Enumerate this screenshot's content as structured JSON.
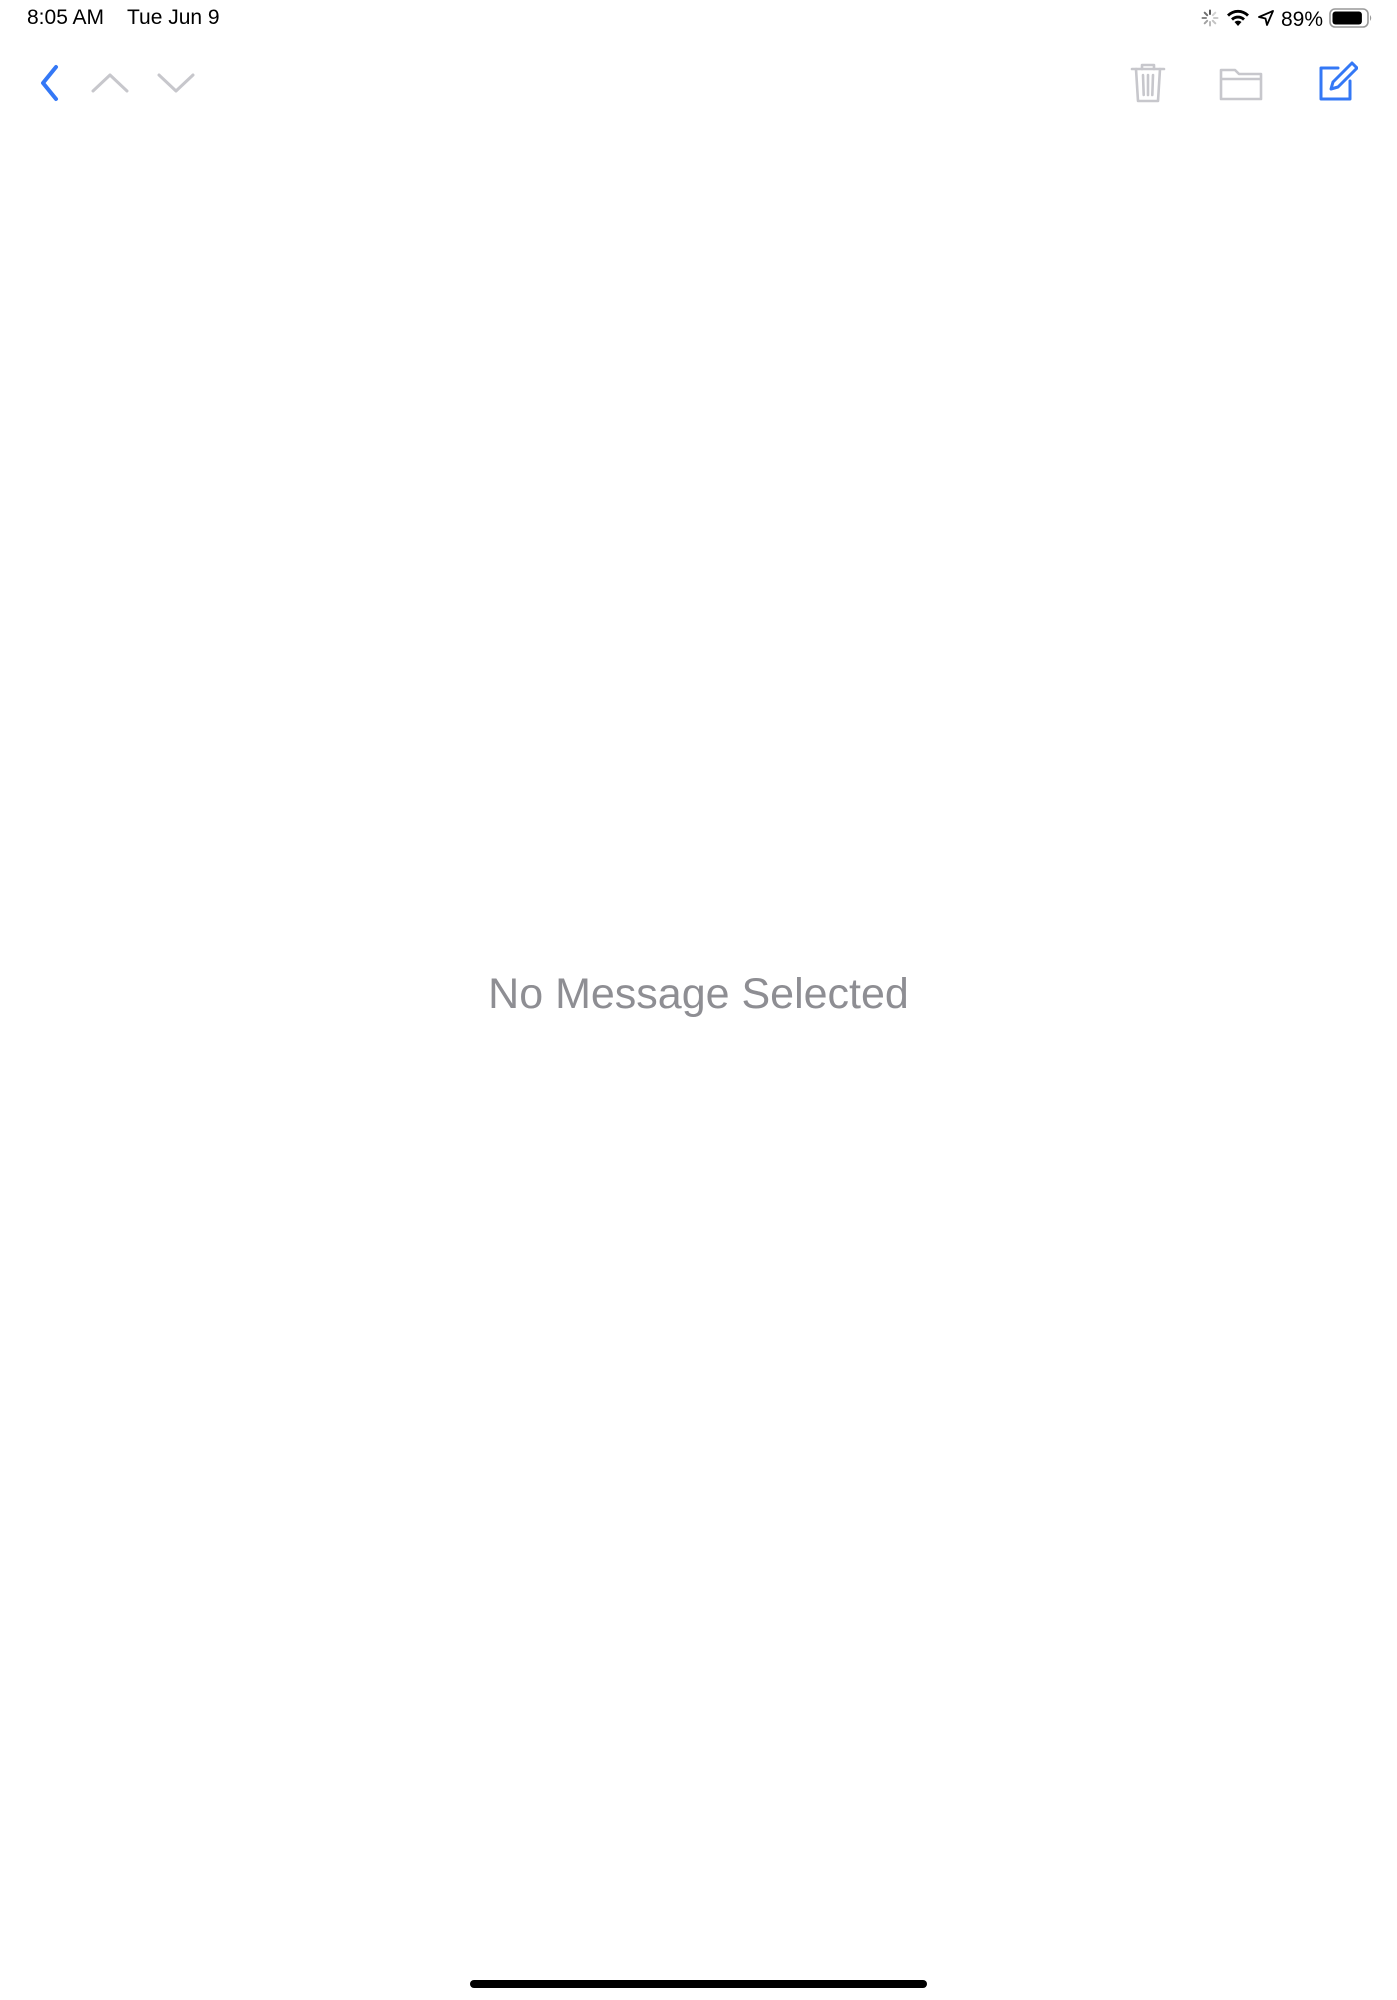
{
  "status_bar": {
    "time": "8:05 AM",
    "date": "Tue Jun 9",
    "battery_percent": "89%",
    "battery_level": 0.89,
    "icons": [
      "activity-spinner-icon",
      "wifi-icon",
      "location-arrow-icon",
      "battery-icon"
    ]
  },
  "toolbar": {
    "left_icons": [
      "back-chevron-icon",
      "previous-message-icon",
      "next-message-icon"
    ],
    "right_icons": [
      "trash-icon",
      "folder-icon",
      "compose-icon"
    ]
  },
  "colors": {
    "accent": "#3478f6",
    "disabled": "#c7c7cc",
    "empty_text": "#8e8e93"
  },
  "main": {
    "empty_message": "No Message Selected"
  }
}
